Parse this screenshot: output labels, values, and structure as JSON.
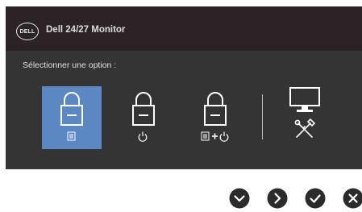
{
  "header": {
    "logo_text": "DELL",
    "title": "Dell 24/27 Monitor"
  },
  "prompt": "Sélectionner une option :",
  "options": [
    {
      "name": "menu-lock",
      "icon": "padlock-menu-icon",
      "selected": true
    },
    {
      "name": "power-lock",
      "icon": "padlock-power-icon",
      "selected": false
    },
    {
      "name": "menu-and-power-lock",
      "icon": "padlock-menu-power-icon",
      "selected": false
    },
    {
      "name": "diagnostics",
      "icon": "monitor-tools-icon",
      "selected": false
    }
  ],
  "nav_buttons": [
    "chevron-down-icon",
    "chevron-up-icon",
    "checkmark-icon",
    "close-icon"
  ],
  "colors": {
    "osd_bg": "#343434",
    "header_bg": "#2b2325",
    "selected": "#5b87c3",
    "button": "#2b2b2b"
  }
}
